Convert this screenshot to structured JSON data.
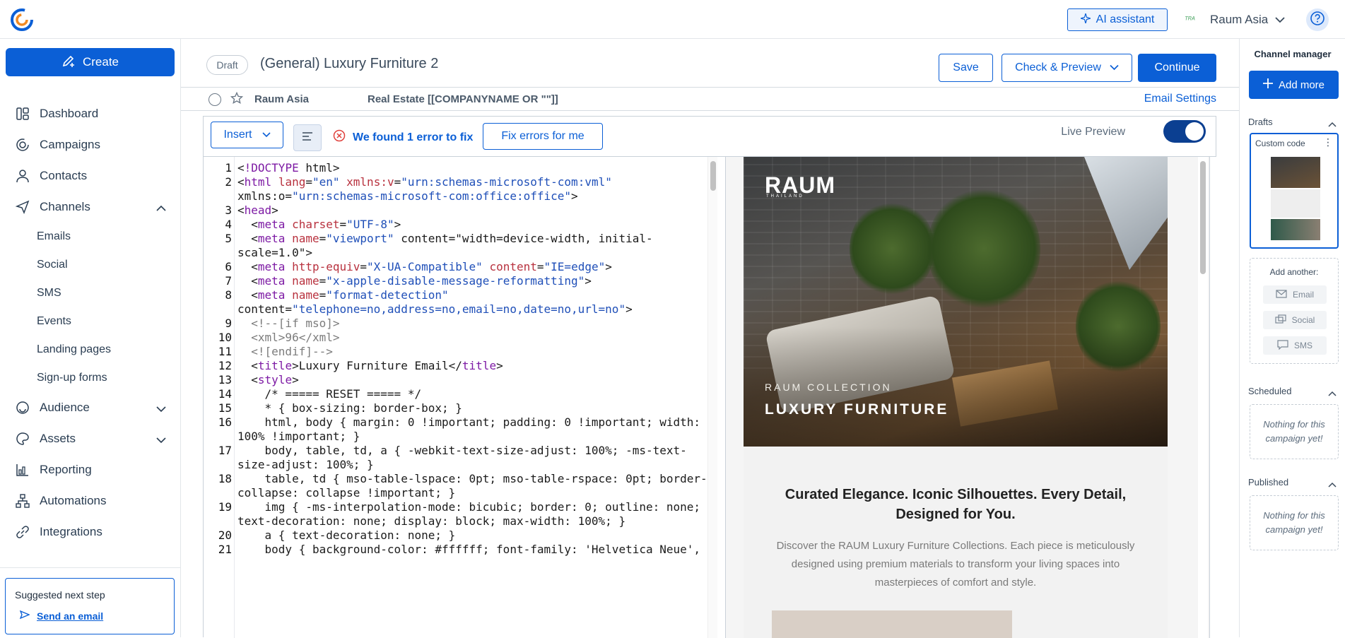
{
  "topbar": {
    "ai_assistant": "AI assistant",
    "account_name": "Raum Asia",
    "account_logo_text": "ᵀᴿᴬ"
  },
  "sidebar": {
    "create_label": "Create",
    "items": [
      {
        "label": "Dashboard",
        "icon": "dashboard-icon"
      },
      {
        "label": "Campaigns",
        "icon": "campaigns-icon"
      },
      {
        "label": "Contacts",
        "icon": "contacts-icon"
      },
      {
        "label": "Channels",
        "icon": "channels-icon",
        "expanded": true
      }
    ],
    "channels_sub": [
      "Emails",
      "Social",
      "SMS",
      "Events",
      "Landing pages",
      "Sign-up forms"
    ],
    "items_after": [
      {
        "label": "Audience",
        "icon": "audience-icon"
      },
      {
        "label": "Assets",
        "icon": "assets-icon"
      },
      {
        "label": "Reporting",
        "icon": "reporting-icon"
      },
      {
        "label": "Automations",
        "icon": "automations-icon"
      },
      {
        "label": "Integrations",
        "icon": "integrations-icon"
      }
    ],
    "suggest_title": "Suggested next step",
    "suggest_link": "Send an email"
  },
  "header": {
    "badge": "Draft",
    "title": "(General) Luxury Furniture 2",
    "save": "Save",
    "check_preview": "Check & Preview",
    "continue": "Continue"
  },
  "meta": {
    "sender": "Raum Asia",
    "subject": "Real Estate [[COMPANYNAME OR \"\"]]",
    "settings": "Email Settings"
  },
  "toolbar": {
    "insert": "Insert",
    "error_text": "We found 1 error to fix",
    "fix_errors": "Fix errors for me",
    "live_preview": "Live Preview",
    "live_preview_on": true
  },
  "code_lines": [
    {
      "n": "1",
      "t": "<!DOCTYPE html>"
    },
    {
      "n": "2",
      "t": "<html lang=\"en\" xmlns:v=\"urn:schemas-microsoft-com:vml\""
    },
    {
      "n": "",
      "t": "xmlns:o=\"urn:schemas-microsoft-com:office:office\">"
    },
    {
      "n": "3",
      "t": "<head>"
    },
    {
      "n": "4",
      "t": "  <meta charset=\"UTF-8\">"
    },
    {
      "n": "5",
      "t": "  <meta name=\"viewport\" content=\"width=device-width, initial-"
    },
    {
      "n": "",
      "t": "scale=1.0\">"
    },
    {
      "n": "6",
      "t": "  <meta http-equiv=\"X-UA-Compatible\" content=\"IE=edge\">"
    },
    {
      "n": "7",
      "t": "  <meta name=\"x-apple-disable-message-reformatting\">"
    },
    {
      "n": "8",
      "t": "  <meta name=\"format-detection\""
    },
    {
      "n": "",
      "t": "content=\"telephone=no,address=no,email=no,date=no,url=no\">"
    },
    {
      "n": "9",
      "t": "  <!--[if mso]>"
    },
    {
      "n": "10",
      "t": "  <xml>96</xml>"
    },
    {
      "n": "11",
      "t": "  <![endif]-->"
    },
    {
      "n": "12",
      "t": "  <title>Luxury Furniture Email</title>"
    },
    {
      "n": "13",
      "t": "  <style>"
    },
    {
      "n": "14",
      "t": "    /* ===== RESET ===== */"
    },
    {
      "n": "15",
      "t": "    * { box-sizing: border-box; }"
    },
    {
      "n": "16",
      "t": "    html, body { margin: 0 !important; padding: 0 !important; width:"
    },
    {
      "n": "",
      "t": "100% !important; }"
    },
    {
      "n": "17",
      "t": "    body, table, td, a { -webkit-text-size-adjust: 100%; -ms-text-"
    },
    {
      "n": "",
      "t": "size-adjust: 100%; }"
    },
    {
      "n": "18",
      "t": "    table, td { mso-table-lspace: 0pt; mso-table-rspace: 0pt; border-"
    },
    {
      "n": "",
      "t": "collapse: collapse !important; }"
    },
    {
      "n": "19",
      "t": "    img { -ms-interpolation-mode: bicubic; border: 0; outline: none;"
    },
    {
      "n": "",
      "t": "text-decoration: none; display: block; max-width: 100%; }"
    },
    {
      "n": "20",
      "t": "    a { text-decoration: none; }"
    },
    {
      "n": "21",
      "t": "    body { background-color: #ffffff; font-family: 'Helvetica Neue',"
    }
  ],
  "preview": {
    "logo": "RAUM",
    "logo_sub": "THAILAND",
    "collection": "RAUM COLLECTION",
    "headline": "LUXURY FURNITURE",
    "heading": "Curated Elegance. Iconic Silhouettes. Every Detail, Designed for You.",
    "body": "Discover the RAUM Luxury Furniture Collections. Each piece is meticulously designed using premium materials to transform your living spaces into masterpieces of comfort and style."
  },
  "rail": {
    "title": "Channel manager",
    "add_more": "Add more",
    "drafts": "Drafts",
    "draft_name": "Custom code",
    "add_another": "Add another:",
    "channels": [
      "Email",
      "Social",
      "SMS"
    ],
    "scheduled": "Scheduled",
    "scheduled_empty": "Nothing for this campaign yet!",
    "published": "Published",
    "published_empty": "Nothing for this campaign yet!"
  },
  "colors": {
    "accent": "#0b5fd6",
    "toggle": "#0b3f91",
    "error": "#e0413c"
  }
}
